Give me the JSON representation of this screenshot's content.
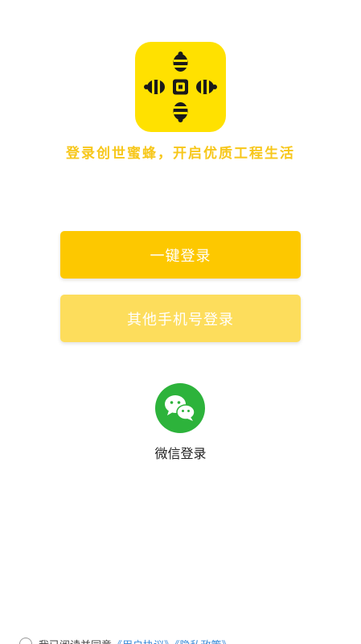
{
  "brand": {
    "logo_icon": "bee-cross-icon",
    "slogan": "登录创世蜜蜂，开启优质工程生活"
  },
  "login": {
    "one_click_label": "一键登录",
    "other_phone_label": "其他手机号登录"
  },
  "wechat": {
    "icon": "wechat-icon",
    "label": "微信登录"
  },
  "agreement": {
    "prefix": "我已阅读并同意",
    "links": "《用户协议》《隐私政策》"
  },
  "colors": {
    "brand_yellow": "#ffe100",
    "primary_button": "#fdc800",
    "secondary_button": "#fddd5c",
    "slogan": "#f7c71a",
    "wechat_green": "#2db33b",
    "link": "#3a8bd8"
  }
}
